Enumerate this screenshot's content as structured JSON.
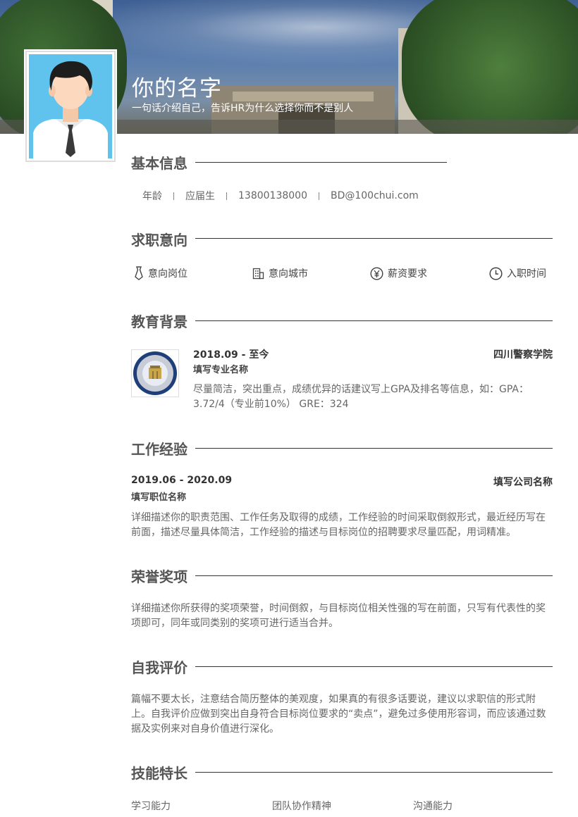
{
  "header": {
    "name": "你的名字",
    "tagline": "一句话介绍自己，告诉HR为什么选择你而不是别人"
  },
  "basic_info": {
    "title": "基本信息",
    "items": [
      "年龄",
      "应届生",
      "13800138000",
      "BD@100chui.com"
    ]
  },
  "job_intent": {
    "title": "求职意向",
    "items": [
      {
        "label": "意向岗位",
        "icon": "tie-icon"
      },
      {
        "label": "意向城市",
        "icon": "building-icon"
      },
      {
        "label": "薪资要求",
        "icon": "yen-icon"
      },
      {
        "label": "入职时间",
        "icon": "clock-icon"
      }
    ]
  },
  "education": {
    "title": "教育背景",
    "period": "2018.09 - 至今",
    "school": "四川警察学院",
    "major": "填写专业名称",
    "desc": "尽量简洁，突出重点，成绩优异的话建议写上GPA及排名等信息，如：GPA：3.72/4（专业前10%） GRE：324"
  },
  "work": {
    "title": "工作经验",
    "period": "2019.06 - 2020.09",
    "company": "填写公司名称",
    "position": "填写职位名称",
    "desc": "详细描述你的职责范围、工作任务及取得的成绩，工作经验的时间采取倒叙形式，最近经历写在前面，描述尽量具体简洁，工作经验的描述与目标岗位的招聘要求尽量匹配，用词精准。"
  },
  "honors": {
    "title": "荣誉奖项",
    "desc": "详细描述你所获得的奖项荣誉，时间倒叙，与目标岗位相关性强的写在前面，只写有代表性的奖项即可，同年或同类别的奖项可进行适当合并。"
  },
  "self_eval": {
    "title": "自我评价",
    "desc": "篇幅不要太长，注意结合简历整体的美观度，如果真的有很多话要说，建议以求职信的形式附上。自我评价应做到突出自身符合目标岗位要求的“卖点”，避免过多使用形容词，而应该通过数据及实例来对自身价值进行深化。"
  },
  "skills": {
    "title": "技能特长",
    "items": [
      "学习能力",
      "团队协作精神",
      "沟通能力"
    ]
  },
  "colors": {
    "avatar_bg": "#5fc3ee",
    "title_text": "#555555",
    "divider": "#333333"
  }
}
